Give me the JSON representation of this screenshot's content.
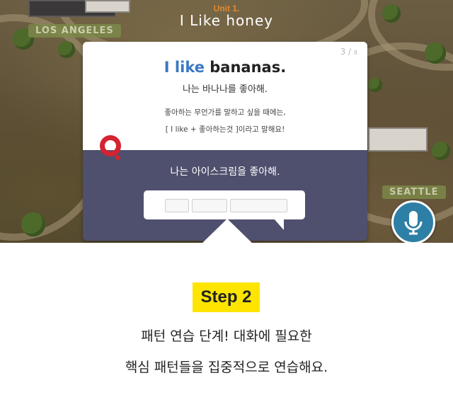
{
  "header": {
    "unit_label": "Unit 1.",
    "unit_title": "I Like honey"
  },
  "card": {
    "page_current": "3",
    "page_total": "8",
    "headline_highlight": "I like",
    "headline_rest": " bananas.",
    "headline_ko": "나는 바나나를 좋아해.",
    "hint_line1": "좋아하는 무언가를 말하고 싶을 때에는,",
    "hint_line2": "[ I like +   좋아하는것 ]이라고 말해요!",
    "question": "나는 아이스크림을 좋아해.",
    "answer_slots": [
      "",
      "",
      ""
    ]
  },
  "map_signs": [
    "LOS ANGELES",
    "SEATTLE"
  ],
  "mic_button": {
    "icon": "microphone-icon"
  },
  "step": {
    "badge": "Step 2",
    "line1": "패턴 연습 단계! 대화에 필요한",
    "line2": "핵심 패턴들을 집중적으로 연습해요."
  },
  "colors": {
    "accent_blue": "#3a78c3",
    "card_bottom": "#4f4f6e",
    "q_red": "#d42331",
    "unit_orange": "#e28a33",
    "step_yellow": "#fde500",
    "mic_blue": "#2e7fa5"
  }
}
